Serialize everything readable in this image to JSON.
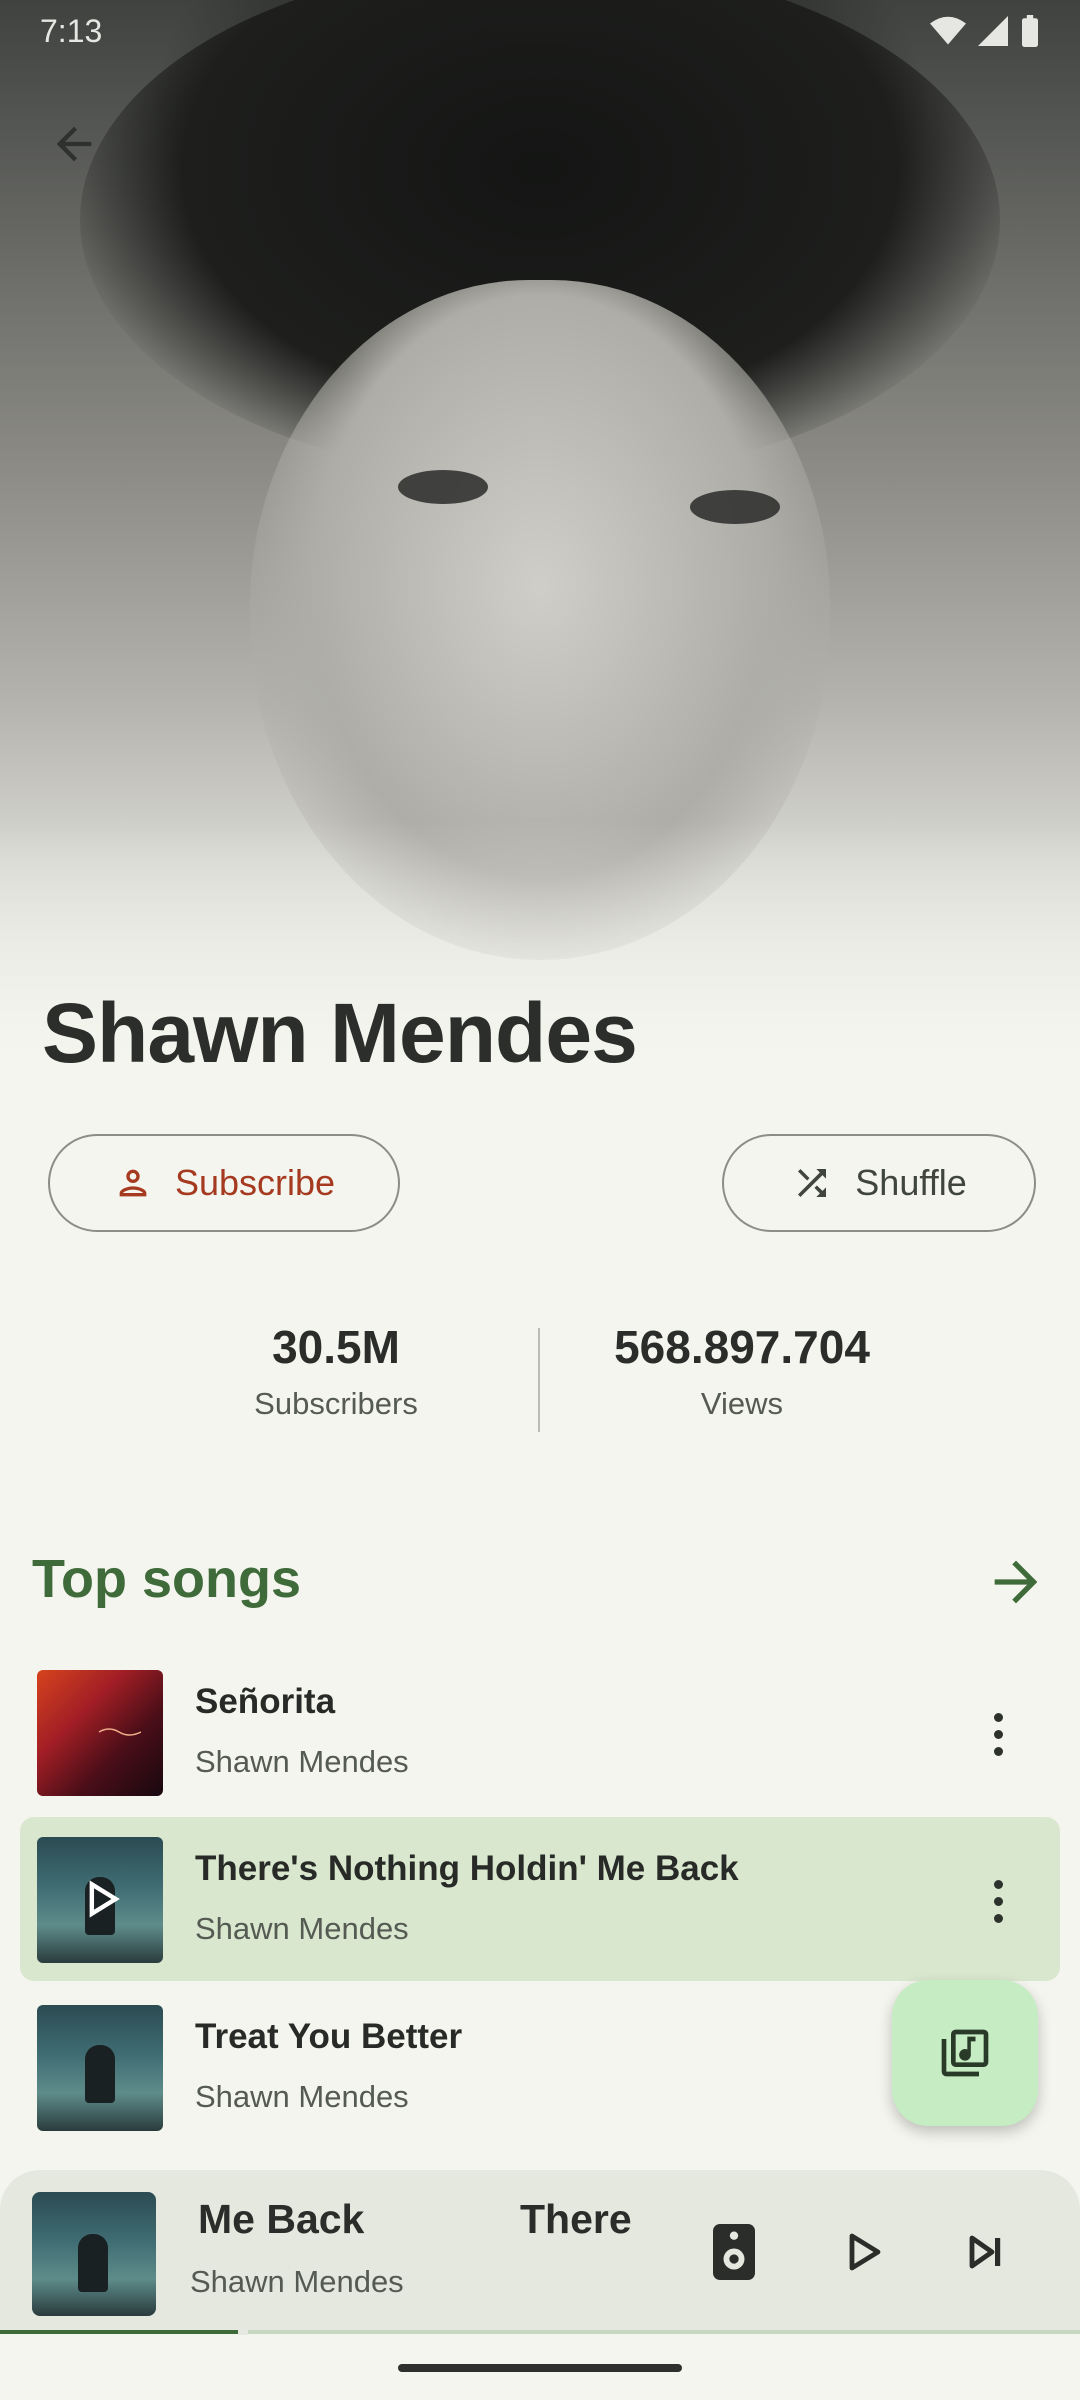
{
  "status_bar": {
    "time": "7:13"
  },
  "artist": {
    "name": "Shawn Mendes"
  },
  "actions": {
    "subscribe_label": "Subscribe",
    "shuffle_label": "Shuffle"
  },
  "stats": {
    "subscribers_value": "30.5M",
    "subscribers_label": "Subscribers",
    "views_value": "568.897.704",
    "views_label": "Views"
  },
  "top_songs": {
    "title": "Top songs",
    "items": [
      {
        "title": "Señorita",
        "artist": "Shawn Mendes",
        "playing": false
      },
      {
        "title": "There's Nothing Holdin' Me Back",
        "artist": "Shawn Mendes",
        "playing": true
      },
      {
        "title": "Treat You Better",
        "artist": "Shawn Mendes",
        "playing": false
      }
    ]
  },
  "mini_player": {
    "title_part_1": "Me Back",
    "title_part_2": "There",
    "artist": "Shawn Mendes",
    "progress": 0.22
  },
  "colors": {
    "accent": "#3f6a3a",
    "subscribe": "#a53a21",
    "active_row": "#d9e7cf",
    "fab": "#c5ecc3",
    "background": "#f4f5ee"
  },
  "icons": {
    "back": "arrow-left-icon",
    "subscribe": "person-icon",
    "shuffle": "shuffle-icon",
    "section_more": "arrow-right-icon",
    "row_more": "more-vert-icon",
    "fab": "music-library-icon",
    "speaker": "speaker-icon",
    "play": "play-icon",
    "next": "skip-next-icon"
  }
}
